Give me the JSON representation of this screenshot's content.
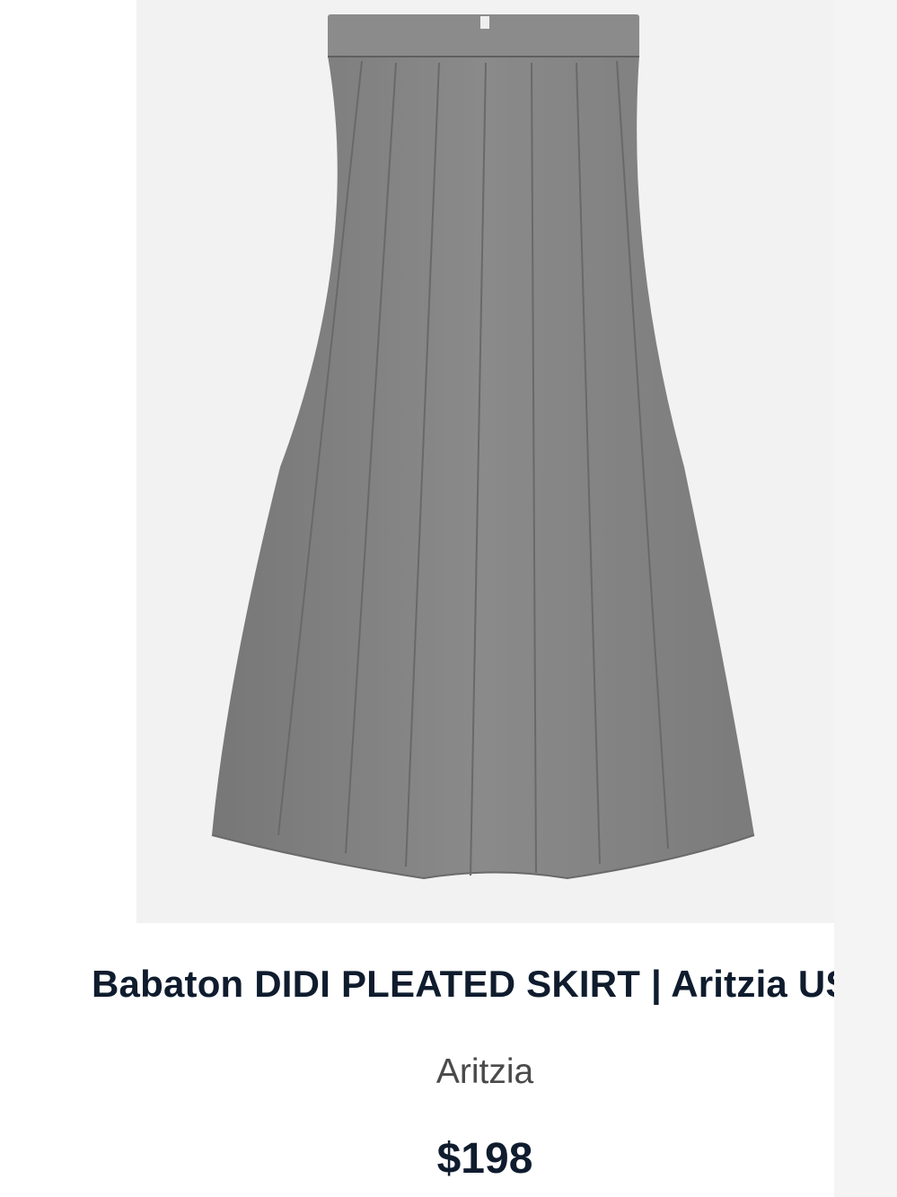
{
  "product": {
    "title": "Babaton DIDI PLEATED SKIRT | Aritzia US",
    "brand": "Aritzia",
    "price": "$198",
    "image_icon": "pleated-skirt-image"
  },
  "colors": {
    "title_text": "#0f1c2e",
    "brand_text": "#4a4a4a",
    "image_background": "#f2f2f2",
    "skirt_gray": "#858585"
  }
}
